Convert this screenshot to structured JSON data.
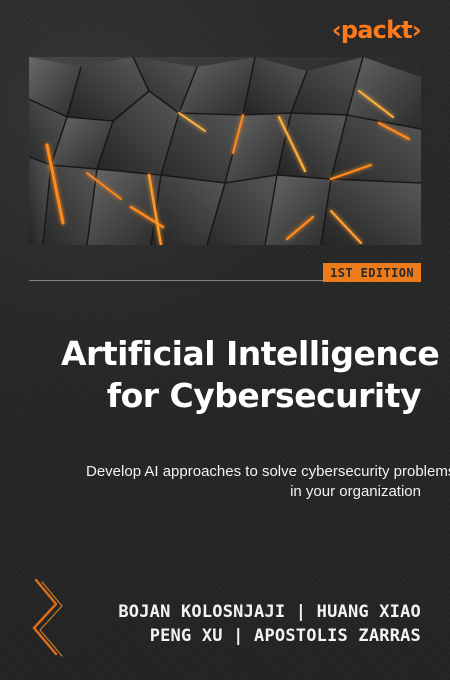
{
  "brand": {
    "logo_text": "‹packt›"
  },
  "edition": "1ST EDITION",
  "title": {
    "line1": "Artificial Intelligence",
    "line2": "for Cybersecurity"
  },
  "subtitle": {
    "line1": "Develop AI approaches to solve cybersecurity problems",
    "line2": "in your organization"
  },
  "authors": {
    "line1": "BOJAN KOLOSNJAJI | HUANG XIAO",
    "line2": "PENG XU | APOSTOLIS ZARRAS"
  },
  "icons": {
    "decor": "chevron-decor-icon"
  },
  "colors": {
    "background": "#262626",
    "accent": "#eb7b1b",
    "text": "#ffffff"
  }
}
